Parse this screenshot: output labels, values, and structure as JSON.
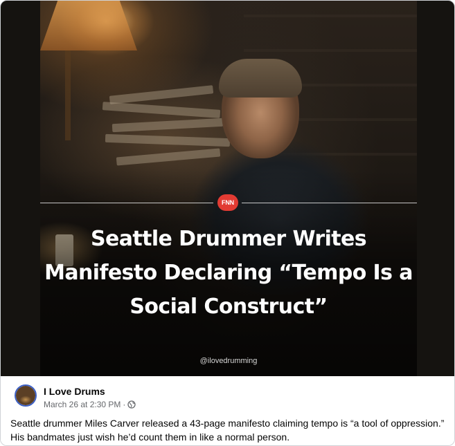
{
  "post": {
    "image": {
      "badge": "FNN",
      "headline": "Seattle Drummer Writes Manifesto Declaring “Tempo Is a Social Construct”",
      "watermark": "@ilovedrumming"
    },
    "author": {
      "name": "I Love Drums",
      "timestamp": "March 26 at 2:30 PM",
      "separator": "·",
      "audience_icon": "globe-icon"
    },
    "caption": "Seattle drummer Miles Carver released a 43-page manifesto claiming tempo is “a tool of oppression.” His bandmates just wish he’d count them in like a normal person."
  },
  "colors": {
    "badge_red": "#e23b33",
    "avatar_ring": "#3b5fc5",
    "meta_gray": "#65676b",
    "text": "#050505"
  }
}
